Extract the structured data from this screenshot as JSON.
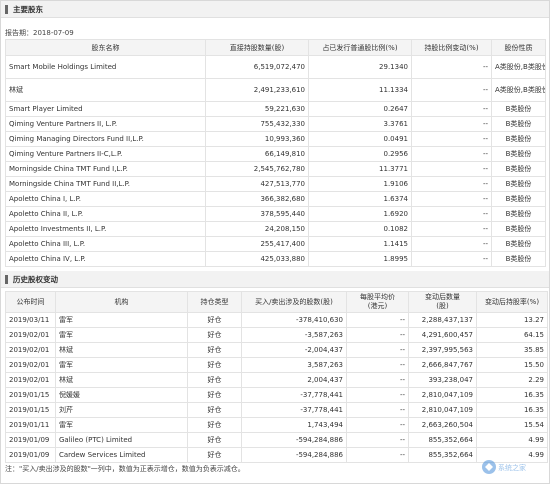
{
  "section1": {
    "title": "主要股东",
    "report_date": "报告期：2018-07-09"
  },
  "holders_headers": [
    "股东名称",
    "直接持股数量(股)",
    "占已发行普通股比例(%)",
    "持股比例变动(%)",
    "股份性质"
  ],
  "holders": [
    {
      "name": "Smart Mobile Holdings Limited",
      "shares": "6,519,072,470",
      "pct": "29.1340",
      "chg": "--",
      "nature": "A类股份,B类股份",
      "tall": true
    },
    {
      "name": "林斌",
      "shares": "2,491,233,610",
      "pct": "11.1334",
      "chg": "--",
      "nature": "A类股份,B类股份",
      "tall": true
    },
    {
      "name": "Smart Player Limited",
      "shares": "59,221,630",
      "pct": "0.2647",
      "chg": "--",
      "nature": "B类股份"
    },
    {
      "name": "Qiming Venture Partners II, L.P.",
      "shares": "755,432,330",
      "pct": "3.3761",
      "chg": "--",
      "nature": "B类股份"
    },
    {
      "name": "Qiming Managing Directors Fund II,L.P.",
      "shares": "10,993,360",
      "pct": "0.0491",
      "chg": "--",
      "nature": "B类股份"
    },
    {
      "name": "Qiming Venture Partners II-C,L.P.",
      "shares": "66,149,810",
      "pct": "0.2956",
      "chg": "--",
      "nature": "B类股份"
    },
    {
      "name": "Morningside China TMT Fund I,L.P.",
      "shares": "2,545,762,780",
      "pct": "11.3771",
      "chg": "--",
      "nature": "B类股份"
    },
    {
      "name": "Morningside China TMT Fund II,L.P.",
      "shares": "427,513,770",
      "pct": "1.9106",
      "chg": "--",
      "nature": "B类股份"
    },
    {
      "name": "Apoletto China I, L.P.",
      "shares": "366,382,680",
      "pct": "1.6374",
      "chg": "--",
      "nature": "B类股份"
    },
    {
      "name": "Apoletto China II, L.P.",
      "shares": "378,595,440",
      "pct": "1.6920",
      "chg": "--",
      "nature": "B类股份"
    },
    {
      "name": "Apoletto Investments II, L.P.",
      "shares": "24,208,150",
      "pct": "0.1082",
      "chg": "--",
      "nature": "B类股份"
    },
    {
      "name": "Apoletto China III, L.P.",
      "shares": "255,417,400",
      "pct": "1.1415",
      "chg": "--",
      "nature": "B类股份"
    },
    {
      "name": "Apoletto China IV, L.P.",
      "shares": "425,033,880",
      "pct": "1.8995",
      "chg": "--",
      "nature": "B类股份"
    }
  ],
  "section2": {
    "title": "历史股权变动"
  },
  "changes_headers": [
    "公布时间",
    "机构",
    "持仓类型",
    "买入/卖出涉及的股数(股)",
    "每股平均价\n(港元)",
    "变动后数量\n(股)",
    "变动后持股率(%)"
  ],
  "changes": [
    {
      "date": "2019/03/11",
      "org": "雷军",
      "type": "好仓",
      "qty": "-378,410,630",
      "avg": "--",
      "after": "2,288,437,137",
      "rate": "13.27"
    },
    {
      "date": "2019/02/01",
      "org": "雷军",
      "type": "好仓",
      "qty": "-3,587,263",
      "avg": "--",
      "after": "4,291,600,457",
      "rate": "64.15"
    },
    {
      "date": "2019/02/01",
      "org": "林斌",
      "type": "好仓",
      "qty": "-2,004,437",
      "avg": "--",
      "after": "2,397,995,563",
      "rate": "35.85"
    },
    {
      "date": "2019/02/01",
      "org": "雷军",
      "type": "好仓",
      "qty": "3,587,263",
      "avg": "--",
      "after": "2,666,847,767",
      "rate": "15.50"
    },
    {
      "date": "2019/02/01",
      "org": "林斌",
      "type": "好仓",
      "qty": "2,004,437",
      "avg": "--",
      "after": "393,238,047",
      "rate": "2.29"
    },
    {
      "date": "2019/01/15",
      "org": "倪媛媛",
      "type": "好仓",
      "qty": "-37,778,441",
      "avg": "--",
      "after": "2,810,047,109",
      "rate": "16.35"
    },
    {
      "date": "2019/01/15",
      "org": "刘芹",
      "type": "好仓",
      "qty": "-37,778,441",
      "avg": "--",
      "after": "2,810,047,109",
      "rate": "16.35"
    },
    {
      "date": "2019/01/11",
      "org": "雷军",
      "type": "好仓",
      "qty": "1,743,494",
      "avg": "--",
      "after": "2,663,260,504",
      "rate": "15.54"
    },
    {
      "date": "2019/01/09",
      "org": "Galileo (PTC) Limited",
      "type": "好仓",
      "qty": "-594,284,886",
      "avg": "--",
      "after": "855,352,664",
      "rate": "4.99"
    },
    {
      "date": "2019/01/09",
      "org": "Cardew Services Limited",
      "type": "好仓",
      "qty": "-594,284,886",
      "avg": "--",
      "after": "855,352,664",
      "rate": "4.99"
    }
  ],
  "note": "注：\"买入/卖出涉及的股数\"一列中，数值为正表示增仓，数值为负表示减仓。",
  "watermark": "win10系统之家"
}
